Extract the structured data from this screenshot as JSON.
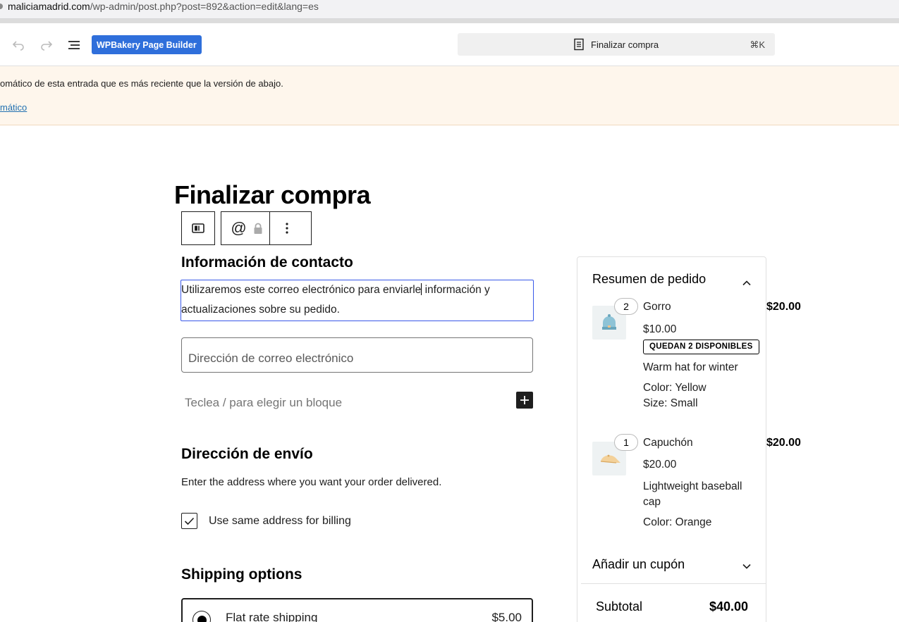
{
  "browser": {
    "url_host": "maliciamadrid.com",
    "url_path": "/wp-admin/post.php?post=892&action=edit&lang=es"
  },
  "toolbar": {
    "undo_icon": "undo-icon",
    "redo_icon": "redo-icon",
    "list_view_icon": "list-view-icon",
    "wpbakery_label": "WPBakery Page Builder",
    "command_title": "Finalizar compra",
    "command_shortcut": "⌘K",
    "accent": "#2f6fdb"
  },
  "notice": {
    "message": "omático de esta entrada que es más reciente que la versión de abajo.",
    "link": "mático"
  },
  "page": {
    "title": "Finalizar compra"
  },
  "contact": {
    "heading": "Información de contacto",
    "description_before_caret": "Utilizaremos este correo electrónico para enviarle",
    "description_after_caret": " información y actualizaciones sobre su pedido.",
    "email_placeholder": "Dirección de correo electrónico"
  },
  "appender": {
    "placeholder": "Teclea / para elegir un bloque"
  },
  "shipping_address": {
    "heading": "Dirección de envío",
    "description": "Enter the address where you want your order delivered.",
    "billing_checkbox_label": "Use same address for billing",
    "billing_checked": true
  },
  "shipping_options": {
    "heading": "Shipping options",
    "option_name": "Flat rate shipping",
    "option_price": "$5.00",
    "selected": true
  },
  "order_summary": {
    "heading": "Resumen de pedido",
    "items": [
      {
        "quantity": "2",
        "name": "Gorro",
        "unit_price": "$10.00",
        "badge": "QUEDAN 2 DISPONIBLES",
        "description": "Warm hat for winter",
        "attributes": [
          "Color: Yellow",
          "Size: Small"
        ],
        "line_total": "$20.00"
      },
      {
        "quantity": "1",
        "name": "Capuchón",
        "unit_price": "$20.00",
        "description_line1": "Lightweight baseball",
        "description_line2": "cap",
        "attributes": [
          "Color: Orange"
        ],
        "line_total": "$20.00"
      }
    ],
    "coupon_label": "Añadir un cupón",
    "subtotal_label": "Subtotal",
    "subtotal_value": "$40.00"
  }
}
